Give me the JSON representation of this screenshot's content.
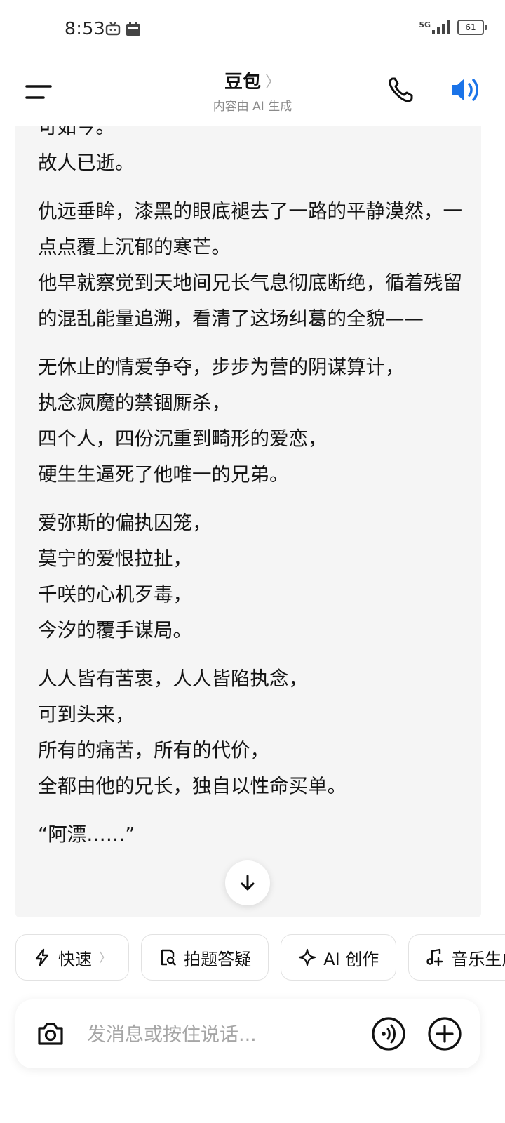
{
  "status_bar": {
    "time": "8:53",
    "network": "5G",
    "battery": "61"
  },
  "header": {
    "title": "豆包",
    "subtitle": "内容由 AI 生成",
    "accent_color": "#1a73e8"
  },
  "message": {
    "paragraphs": [
      [
        "可如今。",
        "故人已逝。"
      ],
      [
        "仇远垂眸，漆黑的眼底褪去了一路的平静漠然，一点点覆上沉郁的寒芒。",
        "他早就察觉到天地间兄长气息彻底断绝，循着残留的混乱能量追溯，看清了这场纠葛的全貌——"
      ],
      [
        "无休止的情爱争夺，步步为营的阴谋算计，",
        "执念疯魔的禁锢厮杀，",
        "四个人，四份沉重到畸形的爱恋，",
        "硬生生逼死了他唯一的兄弟。"
      ],
      [
        "爱弥斯的偏执囚笼，",
        "莫宁的爱恨拉扯，",
        "千咲的心机歹毒，",
        "今汐的覆手谋局。"
      ],
      [
        "人人皆有苦衷，人人皆陷执念，",
        "可到头来，",
        "所有的痛苦，所有的代价，",
        "全都由他的兄长，独自以性命买单。"
      ],
      [
        "“阿漂……”"
      ]
    ]
  },
  "chips": [
    {
      "label": "快速",
      "icon": "lightning-icon",
      "has_chevron": true
    },
    {
      "label": "拍题答疑",
      "icon": "photo-search-icon",
      "has_chevron": false
    },
    {
      "label": "AI 创作",
      "icon": "sparkle-icon",
      "has_chevron": false
    },
    {
      "label": "音乐生成",
      "icon": "music-icon",
      "has_chevron": false
    }
  ],
  "input": {
    "placeholder": "发消息或按住说话...",
    "value": ""
  }
}
